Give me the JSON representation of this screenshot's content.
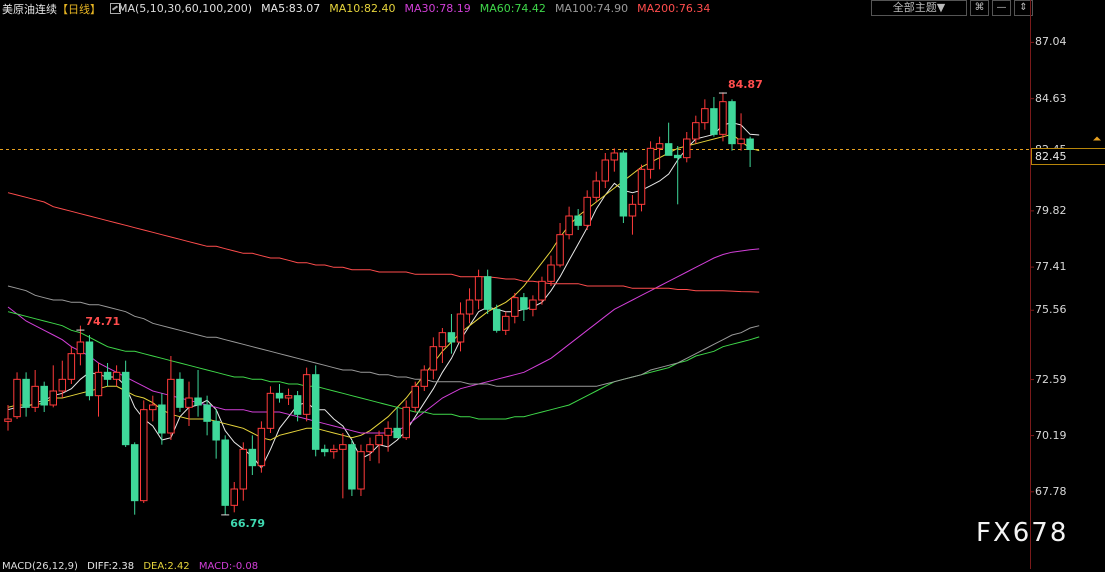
{
  "header": {
    "instrument": "美原油连续",
    "period": "【日线】",
    "ma_spec": "MA(5,10,30,60,100,200)",
    "ma_values": [
      {
        "label": "MA5:83.07",
        "color": "#e8e8e8"
      },
      {
        "label": "MA10:82.40",
        "color": "#e6d43c"
      },
      {
        "label": "MA30:78.19",
        "color": "#d23fd8"
      },
      {
        "label": "MA60:74.42",
        "color": "#3fd84a"
      },
      {
        "label": "MA100:74.90",
        "color": "#9a9a9a"
      },
      {
        "label": "MA200:76.34",
        "color": "#ff4d4d"
      }
    ],
    "theme_select": "全部主题▼",
    "btn_settings": "⌘",
    "btn_minimize": "—",
    "btn_expand": "⇕"
  },
  "watermark": "FX678",
  "macd": {
    "label": "MACD(26,12,9)",
    "diff": "DIFF:2.38",
    "dea": "DEA:2.42",
    "macd": "MACD:-0.08"
  },
  "chart_data": {
    "type": "candlestick",
    "title": "美原油连续【日线】",
    "y_ticks": [
      "87.04",
      "84.63",
      "82.45",
      "79.82",
      "77.41",
      "75.56",
      "72.59",
      "70.19",
      "67.78"
    ],
    "ylim": [
      65.5,
      88.0
    ],
    "current_price": 82.45,
    "annotations": [
      {
        "text": "84.87",
        "index": 79,
        "value": 84.87,
        "color": "#ff4d4d"
      },
      {
        "text": "74.71",
        "index": 8,
        "value": 74.71,
        "color": "#ff4d4d"
      },
      {
        "text": "66.79",
        "index": 24,
        "value": 66.79,
        "color": "#3fd8b0"
      }
    ],
    "colors": {
      "up": "#ff3b3b",
      "down": "#3fd89a",
      "price_line": "#e6a020"
    },
    "candles": [
      [
        70.8,
        71.5,
        70.4,
        70.9
      ],
      [
        71.0,
        72.9,
        70.9,
        72.6
      ],
      [
        72.6,
        72.9,
        71.0,
        71.4
      ],
      [
        71.4,
        73.0,
        71.2,
        72.3
      ],
      [
        72.3,
        72.5,
        71.2,
        71.5
      ],
      [
        71.5,
        73.2,
        71.4,
        72.1
      ],
      [
        72.1,
        73.4,
        71.8,
        72.6
      ],
      [
        72.6,
        74.0,
        72.4,
        73.7
      ],
      [
        73.7,
        74.9,
        73.2,
        74.2
      ],
      [
        74.2,
        74.5,
        71.7,
        71.9
      ],
      [
        71.9,
        73.3,
        71.0,
        72.9
      ],
      [
        72.9,
        73.3,
        72.3,
        72.6
      ],
      [
        72.6,
        73.2,
        72.3,
        72.9
      ],
      [
        72.9,
        73.4,
        69.7,
        69.8
      ],
      [
        69.8,
        69.9,
        66.8,
        67.4
      ],
      [
        67.4,
        71.7,
        67.3,
        71.3
      ],
      [
        71.3,
        71.9,
        70.8,
        71.5
      ],
      [
        71.5,
        72.0,
        69.8,
        70.3
      ],
      [
        70.3,
        73.6,
        70.0,
        72.6
      ],
      [
        72.6,
        72.9,
        71.2,
        71.4
      ],
      [
        71.4,
        72.5,
        70.6,
        71.8
      ],
      [
        71.8,
        73.0,
        71.0,
        71.5
      ],
      [
        71.5,
        71.9,
        70.2,
        70.8
      ],
      [
        70.8,
        71.3,
        69.2,
        70.0
      ],
      [
        70.0,
        70.2,
        66.8,
        67.2
      ],
      [
        67.2,
        68.2,
        66.9,
        67.9
      ],
      [
        67.9,
        69.9,
        67.4,
        69.6
      ],
      [
        69.6,
        70.2,
        68.5,
        68.9
      ],
      [
        68.9,
        70.8,
        68.6,
        70.5
      ],
      [
        70.5,
        72.3,
        70.3,
        72.0
      ],
      [
        72.0,
        72.4,
        71.6,
        71.8
      ],
      [
        71.8,
        72.2,
        71.5,
        71.9
      ],
      [
        71.9,
        72.1,
        70.8,
        71.1
      ],
      [
        71.1,
        73.1,
        70.8,
        72.8
      ],
      [
        72.8,
        73.2,
        69.3,
        69.6
      ],
      [
        69.6,
        69.8,
        69.3,
        69.5
      ],
      [
        69.5,
        69.8,
        69.2,
        69.6
      ],
      [
        69.6,
        70.3,
        67.5,
        69.8
      ],
      [
        69.8,
        70.0,
        67.6,
        67.9
      ],
      [
        67.9,
        69.8,
        67.6,
        69.5
      ],
      [
        69.5,
        70.1,
        69.1,
        69.8
      ],
      [
        69.8,
        70.4,
        69.0,
        70.2
      ],
      [
        70.2,
        70.8,
        69.5,
        70.5
      ],
      [
        70.5,
        71.4,
        70.2,
        70.1
      ],
      [
        70.1,
        71.7,
        70.0,
        71.4
      ],
      [
        71.4,
        72.5,
        71.2,
        72.3
      ],
      [
        72.3,
        73.2,
        72.1,
        73.0
      ],
      [
        73.0,
        74.4,
        72.6,
        74.0
      ],
      [
        74.0,
        74.8,
        73.3,
        74.6
      ],
      [
        74.6,
        75.4,
        73.7,
        74.2
      ],
      [
        74.2,
        75.9,
        73.8,
        75.4
      ],
      [
        75.4,
        76.5,
        75.0,
        76.0
      ],
      [
        76.0,
        77.3,
        75.6,
        77.0
      ],
      [
        77.0,
        77.3,
        75.4,
        75.6
      ],
      [
        75.6,
        75.8,
        74.6,
        74.7
      ],
      [
        74.7,
        75.5,
        74.5,
        75.3
      ],
      [
        75.3,
        76.3,
        75.0,
        76.1
      ],
      [
        76.1,
        76.3,
        75.1,
        75.6
      ],
      [
        75.6,
        76.2,
        75.3,
        76.0
      ],
      [
        76.0,
        77.0,
        75.8,
        76.8
      ],
      [
        76.8,
        77.9,
        76.6,
        77.5
      ],
      [
        77.5,
        79.3,
        77.4,
        78.8
      ],
      [
        78.8,
        80.0,
        78.6,
        79.6
      ],
      [
        79.6,
        79.9,
        79.0,
        79.2
      ],
      [
        79.2,
        80.7,
        79.0,
        80.4
      ],
      [
        80.4,
        81.5,
        80.2,
        81.1
      ],
      [
        81.1,
        82.3,
        80.8,
        82.0
      ],
      [
        82.0,
        82.5,
        81.5,
        82.3
      ],
      [
        82.3,
        82.4,
        79.3,
        79.6
      ],
      [
        79.6,
        80.5,
        78.8,
        80.1
      ],
      [
        80.1,
        81.8,
        79.8,
        81.6
      ],
      [
        81.6,
        82.8,
        81.2,
        82.5
      ],
      [
        82.5,
        83.0,
        81.6,
        82.7
      ],
      [
        82.7,
        83.6,
        82.2,
        82.2
      ],
      [
        82.2,
        82.6,
        80.1,
        82.1
      ],
      [
        82.1,
        83.2,
        81.9,
        82.9
      ],
      [
        82.9,
        83.9,
        82.7,
        83.6
      ],
      [
        83.6,
        84.6,
        83.3,
        84.2
      ],
      [
        84.2,
        84.7,
        83.0,
        83.1
      ],
      [
        83.1,
        84.9,
        82.8,
        84.5
      ],
      [
        84.5,
        84.6,
        82.4,
        82.7
      ],
      [
        82.7,
        84.0,
        82.4,
        82.9
      ],
      [
        82.9,
        83.0,
        81.7,
        82.45
      ]
    ],
    "ma_lines": [
      {
        "name": "MA5",
        "color": "#e8e8e8",
        "values": [
          71.3,
          71.4,
          71.4,
          71.6,
          71.7,
          71.9,
          72.0,
          72.2,
          72.6,
          72.9,
          72.8,
          72.7,
          72.7,
          72.3,
          71.4,
          70.9,
          70.6,
          70.0,
          70.1,
          71.0,
          71.4,
          71.5,
          71.7,
          71.3,
          70.4,
          69.9,
          69.6,
          69.3,
          68.8,
          69.6,
          70.5,
          71.0,
          71.5,
          71.6,
          71.3,
          71.3,
          70.9,
          70.6,
          70.0,
          69.2,
          69.4,
          69.8,
          69.7,
          70.0,
          70.4,
          71.0,
          71.6,
          72.2,
          72.9,
          73.5,
          74.3,
          74.9,
          75.5,
          75.7,
          75.6,
          75.5,
          75.5,
          75.6,
          75.7,
          75.9,
          76.4,
          77.0,
          77.7,
          78.4,
          79.1,
          79.9,
          80.5,
          81.0,
          80.7,
          80.6,
          80.7,
          80.9,
          81.1,
          81.4,
          82.0,
          82.5,
          82.9,
          83.0,
          83.1,
          83.5,
          83.6,
          83.5,
          83.1,
          83.07
        ]
      },
      {
        "name": "MA10",
        "color": "#e6d43c",
        "values": [
          71.4,
          71.5,
          71.5,
          71.5,
          71.6,
          71.8,
          71.8,
          71.9,
          72.0,
          72.1,
          72.2,
          72.3,
          72.3,
          72.1,
          71.9,
          71.8,
          71.6,
          71.3,
          71.1,
          71.0,
          70.9,
          70.9,
          70.9,
          70.8,
          70.7,
          70.6,
          70.5,
          70.3,
          70.1,
          70.0,
          70.2,
          70.3,
          70.4,
          70.5,
          70.5,
          70.4,
          70.3,
          70.2,
          70.1,
          70.2,
          70.4,
          70.7,
          71.0,
          71.4,
          71.8,
          72.3,
          72.8,
          73.3,
          73.8,
          74.2,
          74.6,
          74.9,
          75.2,
          75.5,
          75.7,
          75.9,
          76.2,
          76.6,
          77.1,
          77.6,
          78.1,
          78.7,
          79.2,
          79.6,
          79.9,
          80.2,
          80.5,
          80.8,
          81.1,
          81.4,
          81.7,
          81.9,
          82.1,
          82.3,
          82.5,
          82.6,
          82.7,
          82.8,
          82.9,
          83.0,
          83.1,
          82.8,
          82.5,
          82.4
        ]
      },
      {
        "name": "MA30",
        "color": "#d23fd8",
        "values": [
          75.7,
          75.4,
          75.1,
          74.9,
          74.7,
          74.5,
          74.3,
          74.0,
          73.8,
          73.6,
          73.3,
          73.1,
          72.9,
          72.7,
          72.5,
          72.3,
          72.1,
          72.0,
          71.9,
          71.8,
          71.7,
          71.6,
          71.5,
          71.4,
          71.3,
          71.3,
          71.3,
          71.2,
          71.2,
          71.2,
          71.2,
          71.1,
          71.0,
          70.9,
          70.8,
          70.7,
          70.6,
          70.5,
          70.4,
          70.3,
          70.3,
          70.3,
          70.3,
          70.4,
          70.6,
          70.9,
          71.2,
          71.5,
          71.8,
          72.0,
          72.2,
          72.3,
          72.4,
          72.5,
          72.6,
          72.7,
          72.8,
          72.9,
          73.1,
          73.3,
          73.5,
          73.8,
          74.1,
          74.4,
          74.7,
          75.0,
          75.3,
          75.6,
          75.8,
          76.0,
          76.2,
          76.4,
          76.6,
          76.8,
          77.0,
          77.2,
          77.4,
          77.6,
          77.8,
          77.95,
          78.05,
          78.1,
          78.15,
          78.19
        ]
      },
      {
        "name": "MA60",
        "color": "#3fd84a",
        "values": [
          75.5,
          75.4,
          75.3,
          75.2,
          75.1,
          75.0,
          74.9,
          74.7,
          74.6,
          74.4,
          74.2,
          74.0,
          73.9,
          73.8,
          73.8,
          73.7,
          73.6,
          73.5,
          73.4,
          73.3,
          73.2,
          73.1,
          73.0,
          72.9,
          72.8,
          72.7,
          72.7,
          72.6,
          72.6,
          72.5,
          72.5,
          72.4,
          72.4,
          72.3,
          72.3,
          72.2,
          72.1,
          72.0,
          71.9,
          71.8,
          71.7,
          71.6,
          71.5,
          71.4,
          71.3,
          71.2,
          71.2,
          71.1,
          71.1,
          71.1,
          71.0,
          71.0,
          70.9,
          70.9,
          70.9,
          70.9,
          71.0,
          71.0,
          71.1,
          71.2,
          71.3,
          71.4,
          71.5,
          71.7,
          71.9,
          72.1,
          72.3,
          72.5,
          72.6,
          72.7,
          72.8,
          72.9,
          73.0,
          73.1,
          73.3,
          73.4,
          73.6,
          73.7,
          73.8,
          74.0,
          74.1,
          74.2,
          74.3,
          74.42
        ]
      },
      {
        "name": "MA100",
        "color": "#9a9a9a",
        "values": [
          76.6,
          76.5,
          76.4,
          76.2,
          76.1,
          76.0,
          76.0,
          75.9,
          75.9,
          75.8,
          75.8,
          75.7,
          75.6,
          75.5,
          75.3,
          75.2,
          75.0,
          74.9,
          74.8,
          74.7,
          74.6,
          74.5,
          74.4,
          74.4,
          74.3,
          74.2,
          74.1,
          74.0,
          73.9,
          73.8,
          73.7,
          73.6,
          73.5,
          73.4,
          73.3,
          73.2,
          73.1,
          73.0,
          73.0,
          72.9,
          72.9,
          72.8,
          72.8,
          72.7,
          72.7,
          72.6,
          72.6,
          72.5,
          72.5,
          72.5,
          72.5,
          72.4,
          72.4,
          72.4,
          72.3,
          72.3,
          72.3,
          72.3,
          72.3,
          72.3,
          72.3,
          72.3,
          72.3,
          72.3,
          72.3,
          72.3,
          72.4,
          72.5,
          72.6,
          72.7,
          72.8,
          73.0,
          73.1,
          73.2,
          73.3,
          73.5,
          73.7,
          73.9,
          74.1,
          74.3,
          74.5,
          74.6,
          74.8,
          74.9
        ]
      },
      {
        "name": "MA200",
        "color": "#ff4d4d",
        "values": [
          80.6,
          80.5,
          80.4,
          80.3,
          80.2,
          80.0,
          79.9,
          79.8,
          79.7,
          79.6,
          79.5,
          79.4,
          79.3,
          79.2,
          79.1,
          79.0,
          78.9,
          78.8,
          78.7,
          78.6,
          78.5,
          78.4,
          78.3,
          78.3,
          78.2,
          78.1,
          78.0,
          78.0,
          77.9,
          77.8,
          77.8,
          77.7,
          77.6,
          77.6,
          77.5,
          77.5,
          77.4,
          77.4,
          77.3,
          77.3,
          77.3,
          77.2,
          77.2,
          77.2,
          77.2,
          77.1,
          77.1,
          77.1,
          77.1,
          77.1,
          77.0,
          77.0,
          77.0,
          77.0,
          76.95,
          76.9,
          76.9,
          76.8,
          76.8,
          76.75,
          76.7,
          76.7,
          76.7,
          76.7,
          76.6,
          76.6,
          76.6,
          76.6,
          76.6,
          76.5,
          76.5,
          76.5,
          76.5,
          76.5,
          76.45,
          76.45,
          76.4,
          76.4,
          76.4,
          76.4,
          76.38,
          76.36,
          76.35,
          76.34
        ]
      }
    ]
  }
}
